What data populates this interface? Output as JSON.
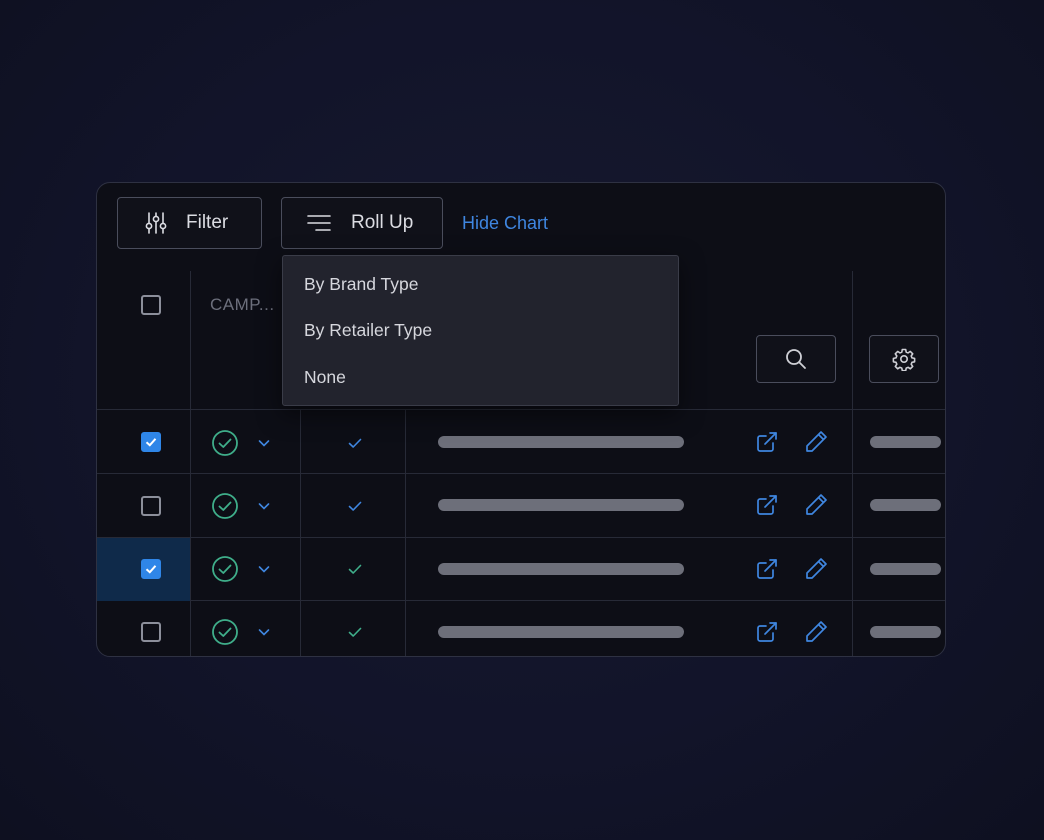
{
  "toolbar": {
    "filter_label": "Filter",
    "filter_icon": "sliders-icon",
    "rollup_label": "Roll Up",
    "rollup_icon": "lines-icon",
    "hide_chart_label": "Hide Chart"
  },
  "table": {
    "column_header": "CAMP...",
    "search_icon": "search-icon",
    "settings_icon": "gear-icon",
    "rows": [
      {
        "selected": true,
        "highlighted": false
      },
      {
        "selected": false,
        "highlighted": false
      },
      {
        "selected": true,
        "highlighted": true
      },
      {
        "selected": false,
        "highlighted": false
      }
    ]
  },
  "rollup_menu": {
    "options": [
      "By Brand Type",
      "By Retailer Type",
      "None"
    ]
  },
  "colors": {
    "accent": "#3f86e0",
    "checkbox_checked": "#2f86e8",
    "status_green": "#3fae8a",
    "row_highlight": "#0f2a4a"
  }
}
